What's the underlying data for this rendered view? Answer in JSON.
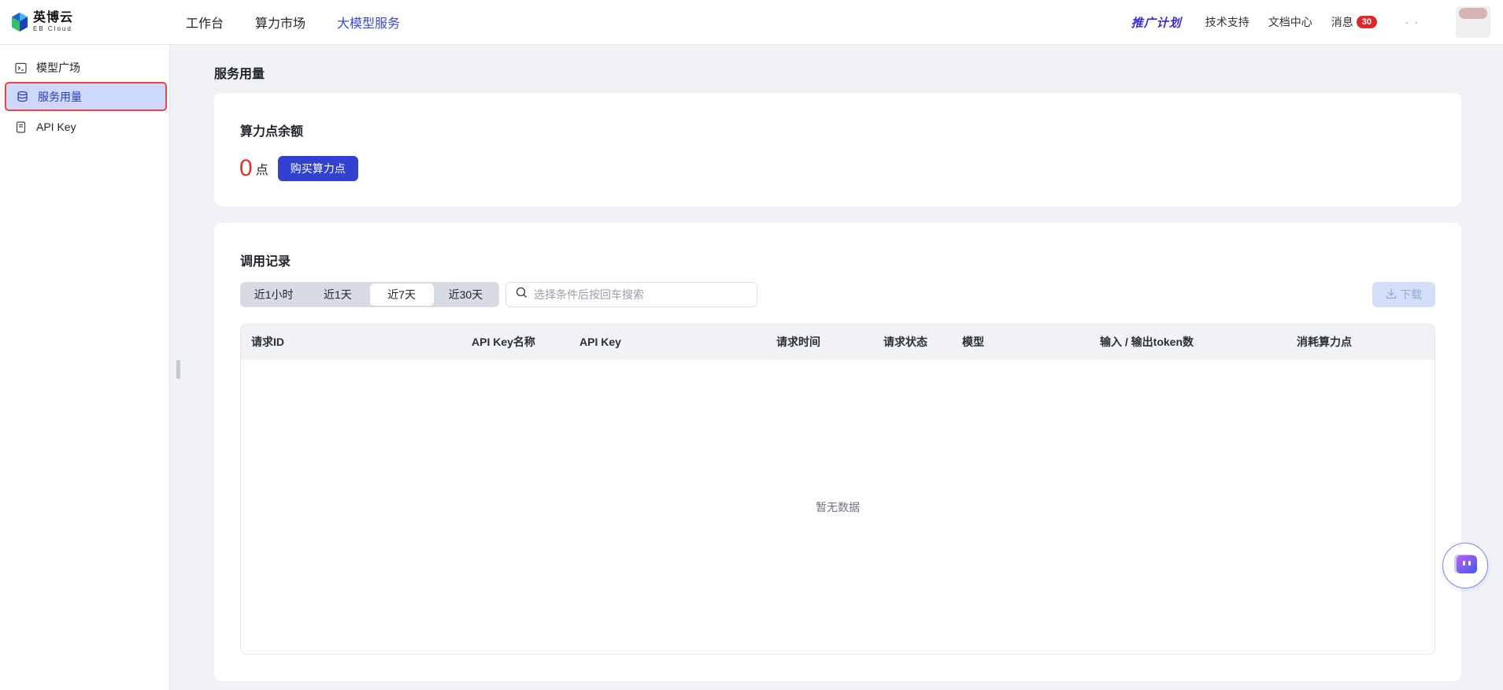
{
  "brand": {
    "name_cn": "英博云",
    "name_en": "EB Cloud"
  },
  "topnav": [
    {
      "label": "工作台",
      "active": false
    },
    {
      "label": "算力市场",
      "active": false
    },
    {
      "label": "大模型服务",
      "active": true
    }
  ],
  "topright": {
    "promo": "推广计划",
    "support": "技术支持",
    "docs": "文档中心",
    "messages": "消息",
    "message_count": "30"
  },
  "sidebar": {
    "items": [
      {
        "label": "模型广场",
        "icon": "terminal-icon",
        "active": false
      },
      {
        "label": "服务用量",
        "icon": "database-icon",
        "active": true
      },
      {
        "label": "API Key",
        "icon": "key-card-icon",
        "active": false
      }
    ]
  },
  "page": {
    "title": "服务用量"
  },
  "balance": {
    "title": "算力点余额",
    "value": "0",
    "unit": "点",
    "buy_label": "购买算力点"
  },
  "records": {
    "title": "调用记录",
    "ranges": [
      "近1小时",
      "近1天",
      "近7天",
      "近30天"
    ],
    "active_range": "近7天",
    "search_placeholder": "选择条件后按回车搜索",
    "download_label": "下载",
    "columns": [
      "请求ID",
      "API Key名称",
      "API Key",
      "请求时间",
      "请求状态",
      "模型",
      "输入 / 输出token数",
      "消耗算力点"
    ],
    "empty_text": "暂无数据"
  },
  "colors": {
    "accent": "#3341d3",
    "active_nav": "#3a4ad6",
    "balance_number": "#e8332a",
    "badge": "#e02727"
  }
}
